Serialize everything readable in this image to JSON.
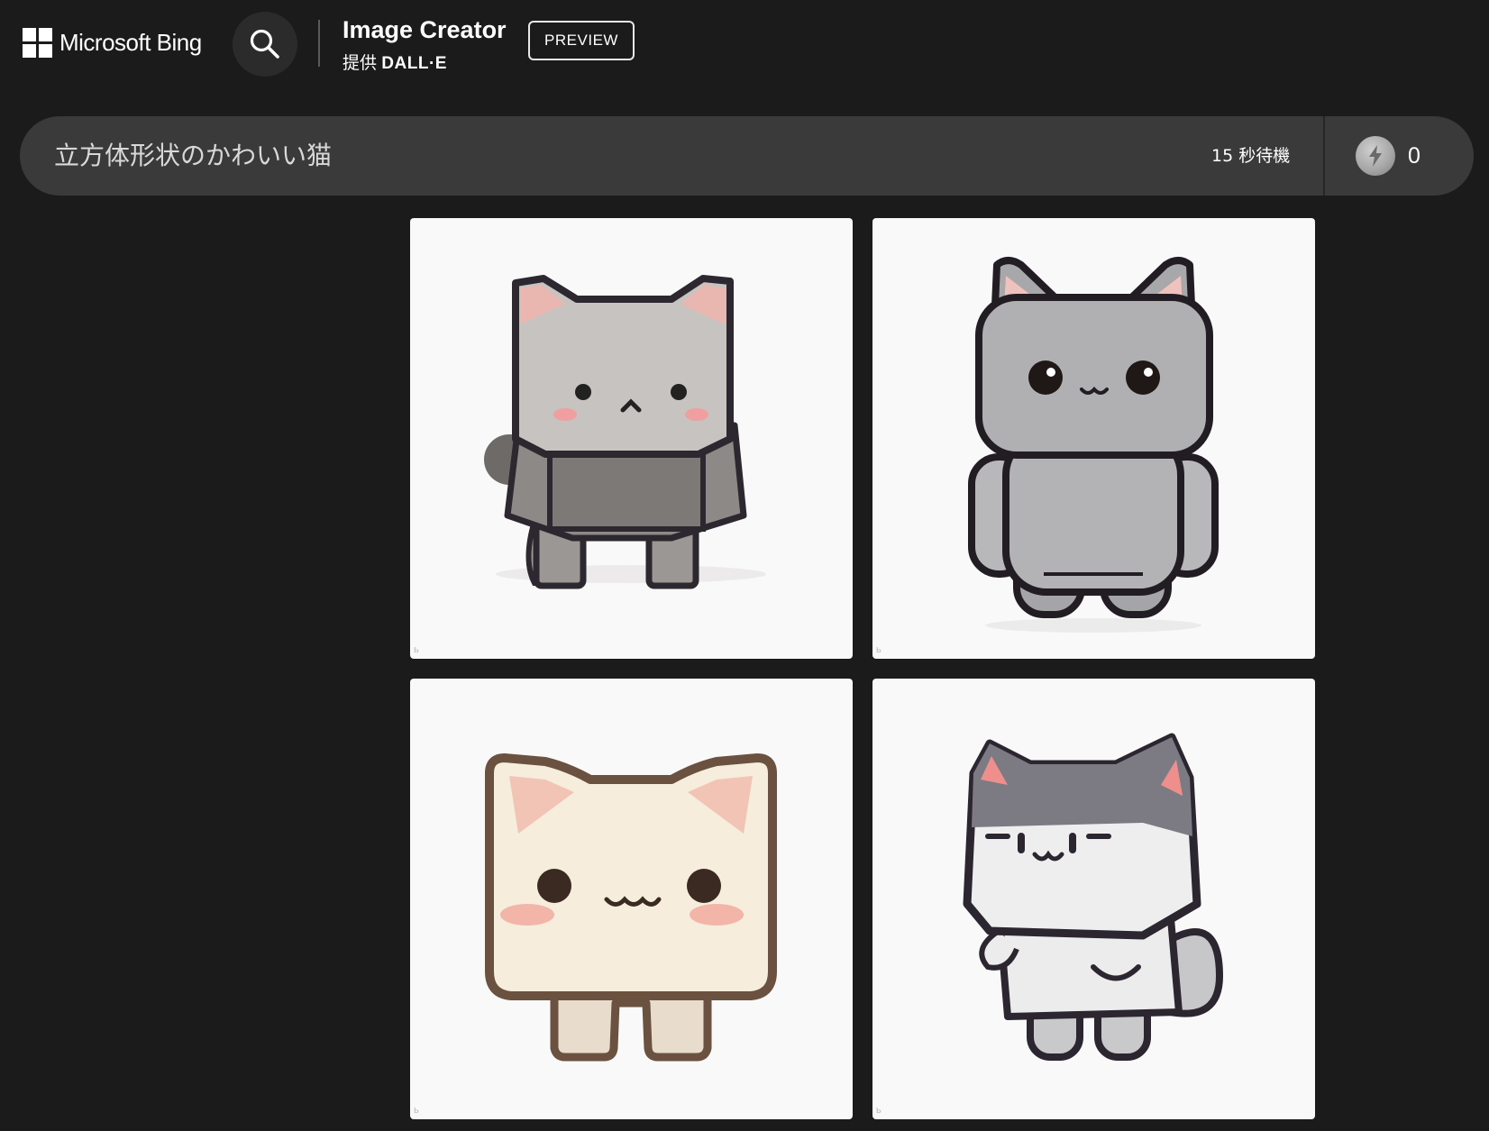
{
  "header": {
    "brand": "Microsoft Bing",
    "search_icon": "search-icon",
    "app_title": "Image Creator",
    "provided_by_prefix": "提供",
    "provided_by_name": "DALL·E",
    "preview_label": "PREVIEW"
  },
  "prompt": {
    "text": "立方体形状のかわいい猫",
    "wait_label": "15 秒待機",
    "boost_icon": "boost-coin-icon",
    "boost_count": "0"
  },
  "images": [
    {
      "subject": "gray cube-shaped cat",
      "icon": "cat-image"
    },
    {
      "subject": "gray rounded cat",
      "icon": "cat-image"
    },
    {
      "subject": "cream cube cat",
      "icon": "cat-image"
    },
    {
      "subject": "gray and white cat",
      "icon": "cat-image"
    }
  ],
  "colors": {
    "background": "#1b1b1b",
    "prompt_bar": "#3a3a3a",
    "tile": "#f9f9fa"
  }
}
